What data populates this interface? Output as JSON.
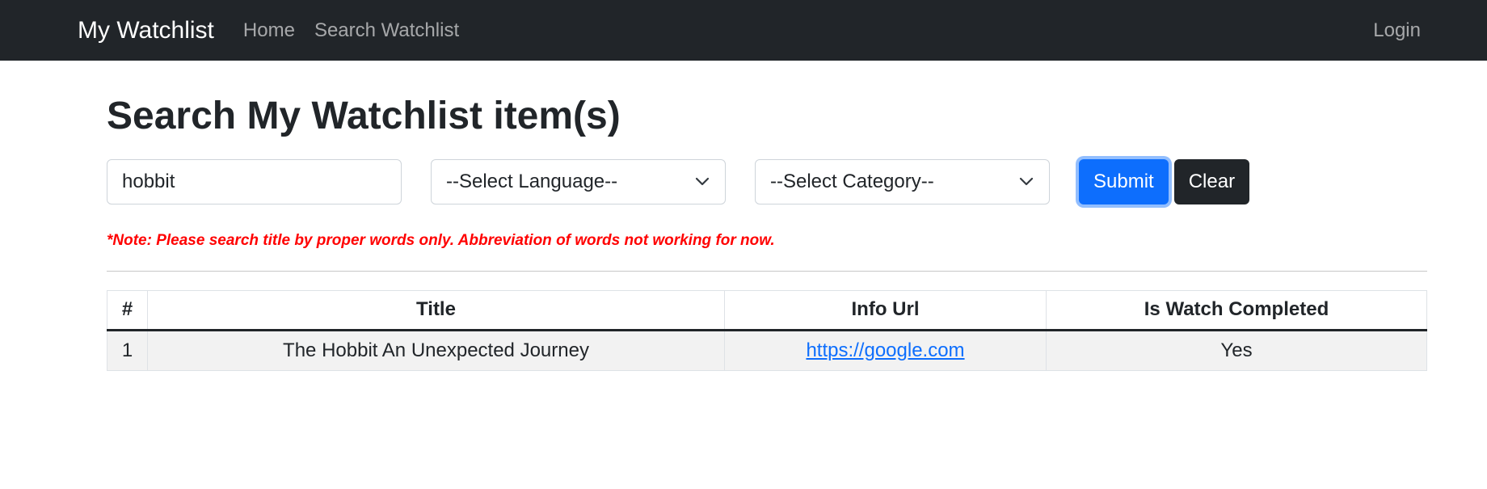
{
  "navbar": {
    "brand": "My Watchlist",
    "links": [
      {
        "label": "Home"
      },
      {
        "label": "Search Watchlist"
      }
    ],
    "login_label": "Login"
  },
  "page": {
    "title": "Search My Watchlist item(s)"
  },
  "search": {
    "title_value": "hobbit",
    "language_select": "--Select Language--",
    "category_select": "--Select Category--",
    "submit_label": "Submit",
    "clear_label": "Clear",
    "note": "*Note: Please search title by proper words only. Abbreviation of words not working for now."
  },
  "table": {
    "headers": [
      "#",
      "Title",
      "Info Url",
      "Is Watch Completed"
    ],
    "rows": [
      {
        "num": "1",
        "title": "The Hobbit An Unexpected Journey",
        "url": "https://google.com",
        "completed": "Yes"
      }
    ]
  },
  "colors": {
    "navbar_bg": "#212529",
    "primary": "#0d6efd",
    "note": "#ff0000"
  }
}
